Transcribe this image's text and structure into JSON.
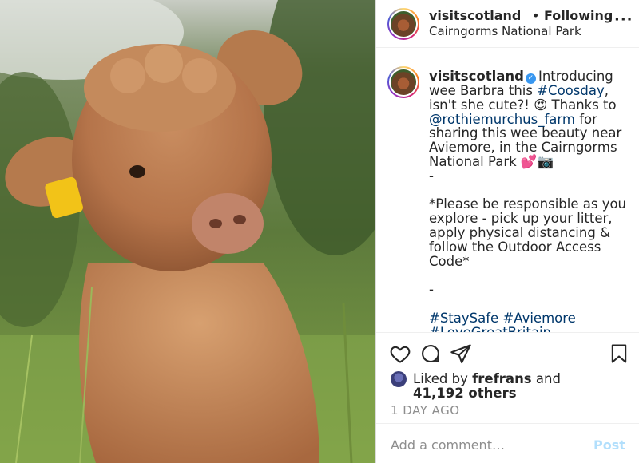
{
  "header": {
    "username": "visitscotland",
    "separator": "•",
    "follow_status": "Following",
    "location": "Cairngorms National Park",
    "more_label": "···"
  },
  "caption": {
    "username": "visitscotland",
    "verified_mark": "✓",
    "text_before_hashtag": "Introducing wee Barbra this ",
    "hashtag_coosday": "#Coosday",
    "text_after_hashtag": ", isn't she cute?! 😍 Thanks to ",
    "mention": "@rothiemurchus_farm",
    "text_after_mention": " for sharing this wee beauty near Aviemore, in the Cairngorms National Park 💕📷\n-\n\n*Please be responsible as you explore - pick up your litter, apply physical distancing & follow the Outdoor Access Code*\n\n-\n\n",
    "hashtags_line1": "#StaySafe #Aviemore",
    "hashtags_line2": "#LoveGreatBritain"
  },
  "likes": {
    "prefix": "Liked by ",
    "liker": "frefrans",
    "middle": " and",
    "count_text": "41,192 others"
  },
  "timestamp": "1 DAY AGO",
  "comment": {
    "placeholder": "Add a comment…",
    "post_label": "Post"
  },
  "colors": {
    "link": "#00376b",
    "verified": "#3897f0",
    "post_button_disabled": "#b2dffc"
  },
  "icons": {
    "like": "heart-icon",
    "comment": "comment-icon",
    "share": "share-icon",
    "save": "bookmark-icon"
  }
}
